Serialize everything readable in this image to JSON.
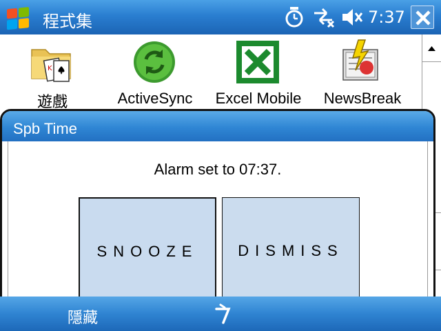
{
  "titlebar": {
    "title": "程式集",
    "start_icon": "windows-flag-icon",
    "status_icons": [
      "alarm-clock-icon",
      "connectivity-icon",
      "speaker-muted-icon"
    ],
    "clock": "7:37",
    "close_icon": "close-x-icon"
  },
  "programs": [
    {
      "label": "遊戲",
      "icon": "games-folder-icon"
    },
    {
      "label": "ActiveSync",
      "icon": "activesync-icon"
    },
    {
      "label": "Excel Mobile",
      "icon": "excel-icon"
    },
    {
      "label": "NewsBreak",
      "icon": "newsbreak-icon"
    }
  ],
  "dialog": {
    "title": "Spb Time",
    "message": "Alarm set to 07:37.",
    "snooze_label": "SNOOZE",
    "dismiss_label": "DISMISS"
  },
  "softbar": {
    "left_label": "隱藏",
    "sip_icon": "input-panel-icon"
  },
  "colors": {
    "title_bar_blue": "#2a7ed0",
    "button_fill": "#c9dbef",
    "text_white": "#ffffff"
  }
}
